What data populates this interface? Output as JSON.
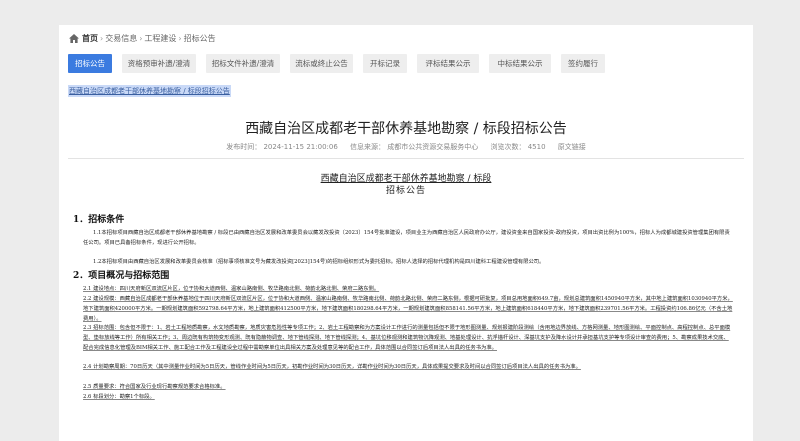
{
  "breadcrumb": {
    "home": "首页",
    "items": [
      "交易信息",
      "工程建设",
      "招标公告"
    ]
  },
  "tabs": [
    {
      "label": "招标公告",
      "active": true
    },
    {
      "label": "资格预审补遗/澄清",
      "active": false
    },
    {
      "label": "招标文件补遗/澄清",
      "active": false
    },
    {
      "label": "流标或终止公告",
      "active": false
    },
    {
      "label": "开标记录",
      "active": false
    },
    {
      "label": "评标结果公示",
      "active": false
    },
    {
      "label": "中标结果公示",
      "active": false
    },
    {
      "label": "签约履行",
      "active": false
    }
  ],
  "highlighted_title": "西藏自治区成都老干部休养基地勘察 / 标段招标公告",
  "title": "西藏自治区成都老干部休养基地勘察 / 标段招标公告",
  "meta": {
    "publish_time": "发布时间： 2024-11-15 21:00:06",
    "source": "信息来源： 成都市公共资源交易服务中心",
    "views": "浏览次数： 4510",
    "original_link": "原文链接"
  },
  "notice": {
    "subtitle": "西藏自治区成都老干部休养基地勘察 / 标段",
    "subtitle2": "招标公告",
    "section1_title": "1．招标条件",
    "para1_1": "1.1本招标项目西藏自治区成都老干部休养基地勘察 / 标段已由西藏自治区发展和改革委员会以藏发改投资〔2023〕154号批准建设，项目业主为西藏自治区人民政府办公厅，建设资金来自国家投资-政府投资，项目出资比例为100%，招标人为成都城建投资管理集团有限责任公司。项目已具备招标条件，现进行公开招标。",
    "para1_2": "1.2本招标项目由西藏自治区发展和改革委员会核准（招标事项核准文号为藏发改投资[2023]154号)的招标组织形式为委托招标。招标人选择的招标代理机构是四川建科工程建设管理有限公司。",
    "section2_title": "2．项目概况与招标范围",
    "para2_1": "2.1 建设地点：四川天府新区双流区片区，位于协和大道西侧、温家山路南侧、牧华路南北侧、荷韵北路北侧、荣府二路东侧。",
    "para2_2": "2.2 建设规模：西藏自治区成都老干部休养基地位于四川天府新区双流区片区，位于协和大道西侧、温家山路南侧、牧华路南北侧、荷韵北路北侧、荣府二路东侧，根据可研批复，项目总用地面积649.7亩，规划总建筑面积1450940平方米，其中地上建筑面积1030940平方米，地下建筑面积420000平方米。一期规划建筑面积592798.64平方米，地上建筑面积412500平方米，地下建筑面积180298.64平方米，一期规划建筑面积858141.56平方米，地上建筑面积618440平方米，地下建筑面积239701.56平方米。工程投资约106.86亿元（不含土地费用）。",
    "para2_3": "2.3 招标范围：包含但不限于：1、岩土工程地质勘察，水文地质勘察，地质灾害危险性等专项工作；2、岩土工程勘察和为方案设计工作进行的测量包括但不限于地形图测量、规划报建阶段测绘（含用地边界放线、方格网测量、地形图测绘、平面控制点、高程控制点、总平面模型、垫标放线等工作）所有相关工作；3、周边既有构筑物变形观测、既有隐蔽物调查、地下管线探测、地下管线探测；4、基坑位移观测和建筑物沉降观测、地基处理设计、抗浮锚杆设计、深基坑支护及降水设计并承担基坑支护等专项设计审查的费用；5、勘察成果技术交底、配合完成信息化管理及BIM相关工作、施工配合工作及工程建设全过程中需勘察单位出具相关方案及处理意见等的配合工作，具体范围以合同签订后项目法人出具的任务书为准。",
    "para2_4": "2.4 计划勘察周期：70日历天（其中测量作业时间为5日历天，管线作业时间为5日历天，初勘作业时间为30日历天，详勘作业时间为30日历天，具体成果提交要求及时间以合同签订后项目法人出具的任务书为准。",
    "para2_5": "2.5 质量要求：符合国家及行业现行勘察规范要求合格标准。",
    "para2_6": "2.6 标段划分：勘察1个标段。"
  }
}
